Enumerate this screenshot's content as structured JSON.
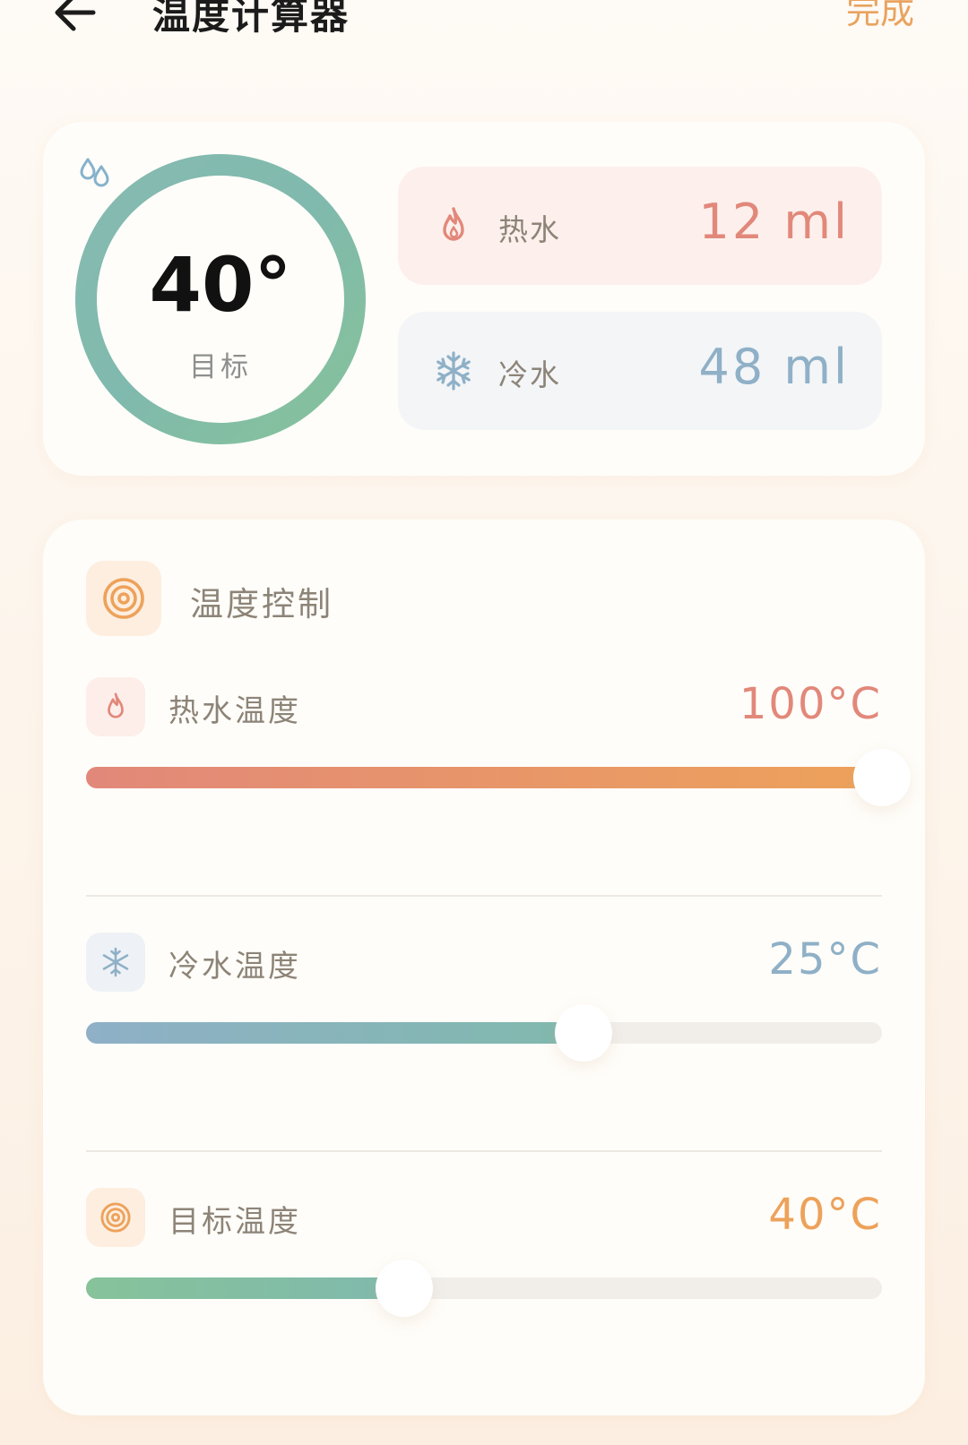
{
  "header": {
    "title": "温度计算器",
    "done_label": "完成"
  },
  "summary": {
    "target_value": "40°",
    "target_label": "目标",
    "hot": {
      "label": "热水",
      "value": "12 ml",
      "color": "#e2887a"
    },
    "cold": {
      "label": "冷水",
      "value": "48 ml",
      "color": "#8fb0c7"
    }
  },
  "controls": {
    "section_title": "温度控制",
    "hot_temp": {
      "label": "热水温度",
      "value": "100°C",
      "fraction": 1.0,
      "color": "#e2887a"
    },
    "cold_temp": {
      "label": "冷水温度",
      "value": "25°C",
      "fraction": 0.625,
      "color": "#8fb0c7"
    },
    "target_temp": {
      "label": "目标温度",
      "value": "40°C",
      "fraction": 0.4,
      "color": "#eda25a"
    }
  },
  "icons": {
    "back": "arrow-left-icon",
    "drop": "water-drops-icon",
    "flame": "flame-icon",
    "snow": "snowflake-icon",
    "target": "target-icon"
  }
}
